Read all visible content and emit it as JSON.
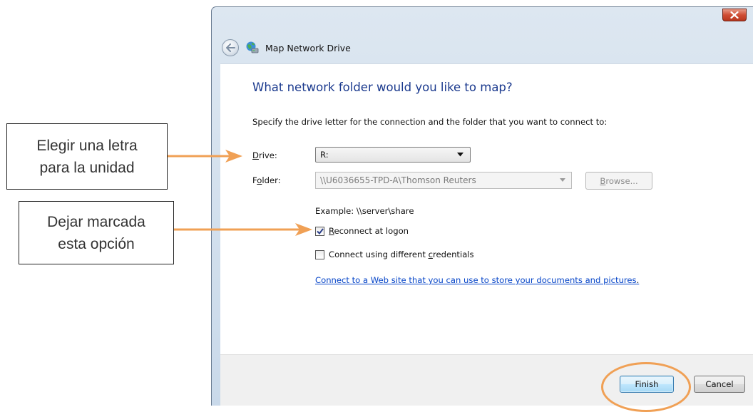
{
  "annotations": {
    "callout_drive": {
      "line1": "Elegir una letra",
      "line2": "para la unidad"
    },
    "callout_reconnect": {
      "line1": "Dejar marcada",
      "line2": "esta opción"
    },
    "arrow_color": "#f0a055"
  },
  "dialog": {
    "wizard_title": "Map Network Drive",
    "heading": "What network folder would you like to map?",
    "instructions": "Specify the drive letter for the connection and the folder that you want to connect to:",
    "drive": {
      "label_accel": "D",
      "label_rest": "rive:",
      "value": "R:"
    },
    "folder": {
      "label_pre": "F",
      "label_accel": "o",
      "label_rest": "lder:",
      "value": "\\\\U6036655-TPD-A\\Thomson Reuters",
      "browse_accel": "B",
      "browse_rest": "rowse..."
    },
    "example": "Example: \\\\server\\share",
    "reconnect": {
      "checked": true,
      "label_accel": "R",
      "label_rest": "econnect at logon"
    },
    "credentials": {
      "checked": false,
      "label_pre": "Connect using different ",
      "label_accel": "c",
      "label_rest": "redentials"
    },
    "web_link": "Connect to a Web site that you can use to store your documents and pictures",
    "web_link_period": ".",
    "finish_label": "Finish",
    "cancel_label": "Cancel",
    "accent_color": "#1b3a8e",
    "link_color": "#0645c8"
  }
}
